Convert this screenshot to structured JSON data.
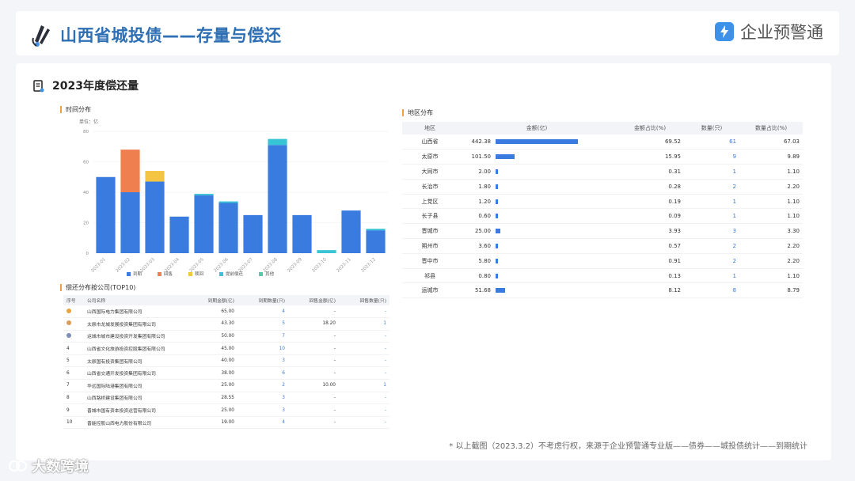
{
  "header": {
    "title": "山西省城投债——存量与偿还",
    "brand": "企业预警通"
  },
  "section": {
    "title": "2023年度偿还量"
  },
  "time_chart": {
    "subtitle": "时间分布",
    "unit": "单位：亿",
    "legend": [
      {
        "label": "到期",
        "color": "#3a7be0"
      },
      {
        "label": "回售",
        "color": "#ef7f4f"
      },
      {
        "label": "赎回",
        "color": "#f4c542"
      },
      {
        "label": "提前偿还",
        "color": "#37c4d4"
      },
      {
        "label": "其他",
        "color": "#58c9a8"
      }
    ]
  },
  "chart_data": {
    "type": "bar",
    "stacked": true,
    "categories": [
      "2023-01",
      "2023-02",
      "2023-03",
      "2023-04",
      "2023-05",
      "2023-06",
      "2023-07",
      "2023-08",
      "2023-09",
      "2023-10",
      "2023-11",
      "2023-12"
    ],
    "series": [
      {
        "name": "到期",
        "color": "#3a7be0",
        "values": [
          50,
          40,
          47,
          24,
          38,
          33,
          25,
          71,
          25,
          0,
          28,
          15
        ]
      },
      {
        "name": "回售",
        "color": "#ef7f4f",
        "values": [
          0,
          28,
          0,
          0,
          0,
          0,
          0,
          0,
          0,
          0,
          0,
          0
        ]
      },
      {
        "name": "赎回",
        "color": "#f4c542",
        "values": [
          0,
          0,
          7,
          0,
          0,
          0,
          0,
          0,
          0,
          0,
          0,
          0
        ]
      },
      {
        "name": "提前偿还",
        "color": "#37c4d4",
        "values": [
          0,
          0,
          0,
          0,
          1,
          1,
          0,
          4,
          0,
          2,
          0,
          1
        ]
      },
      {
        "name": "其他",
        "color": "#58c9a8",
        "values": [
          0,
          0,
          0,
          0,
          0,
          0,
          0,
          0,
          0,
          0,
          0,
          0
        ]
      }
    ],
    "ylim": [
      0,
      80
    ],
    "yticks": [
      0,
      20,
      40,
      60,
      80
    ],
    "grid": true,
    "legend_position": "bottom"
  },
  "top_table": {
    "subtitle": "偿还分布按公司(TOP10)",
    "columns": [
      "序号",
      "公司名称",
      "到期金额(亿)",
      "到期数量(只)",
      "回售金额(亿)",
      "回售数量(只)"
    ],
    "rows": [
      {
        "rank": "",
        "medal": "#e8a43a",
        "name": "山西国际电力集团有限公司",
        "due_amt": "65.00",
        "due_cnt": "4",
        "put_amt": "-",
        "put_cnt": "-"
      },
      {
        "rank": "",
        "medal": "#d89c5a",
        "name": "太原市龙城发展投资集团有限公司",
        "due_amt": "43.30",
        "due_cnt": "5",
        "put_amt": "18.20",
        "put_cnt": "1"
      },
      {
        "rank": "",
        "medal": "#7b8fb8",
        "name": "运城市城市建设投资开发集团有限公司",
        "due_amt": "50.00",
        "due_cnt": "7",
        "put_amt": "-",
        "put_cnt": "-"
      },
      {
        "rank": "4",
        "medal": "",
        "name": "山西省文化旅游投资控股集团有限公司",
        "due_amt": "45.00",
        "due_cnt": "10",
        "put_amt": "-",
        "put_cnt": "-"
      },
      {
        "rank": "5",
        "medal": "",
        "name": "太原国有投资集团有限公司",
        "due_amt": "40.00",
        "due_cnt": "3",
        "put_amt": "-",
        "put_cnt": "-"
      },
      {
        "rank": "6",
        "medal": "",
        "name": "山西省交通开发投资集团有限公司",
        "due_amt": "38.00",
        "due_cnt": "6",
        "put_amt": "-",
        "put_cnt": "-"
      },
      {
        "rank": "7",
        "medal": "",
        "name": "华远国际陆港集团有限公司",
        "due_amt": "25.00",
        "due_cnt": "2",
        "put_amt": "10.00",
        "put_cnt": "1"
      },
      {
        "rank": "8",
        "medal": "",
        "name": "山西路桥建设集团有限公司",
        "due_amt": "28.55",
        "due_cnt": "3",
        "put_amt": "-",
        "put_cnt": "-"
      },
      {
        "rank": "9",
        "medal": "",
        "name": "晋城市国有资本投资运营有限公司",
        "due_amt": "25.00",
        "due_cnt": "3",
        "put_amt": "-",
        "put_cnt": "-"
      },
      {
        "rank": "10",
        "medal": "",
        "name": "晋能控股山西电力股份有限公司",
        "due_amt": "19.00",
        "due_cnt": "4",
        "put_amt": "-",
        "put_cnt": "-"
      }
    ]
  },
  "region_table": {
    "subtitle": "地区分布",
    "columns": [
      "地区",
      "金额(亿)",
      "金额占比(%)",
      "数量(只)",
      "数量占比(%)"
    ],
    "rows": [
      {
        "region": "山西省",
        "amount": "442.38",
        "share": "69.52",
        "count": "61",
        "count_share": "67.03",
        "amount_value": 442.38
      },
      {
        "region": "太原市",
        "amount": "101.50",
        "share": "15.95",
        "count": "9",
        "count_share": "9.89",
        "amount_value": 101.5
      },
      {
        "region": "大同市",
        "amount": "2.00",
        "share": "0.31",
        "count": "1",
        "count_share": "1.10",
        "amount_value": 2.0
      },
      {
        "region": "长治市",
        "amount": "1.80",
        "share": "0.28",
        "count": "2",
        "count_share": "2.20",
        "amount_value": 1.8
      },
      {
        "region": "上党区",
        "amount": "1.20",
        "share": "0.19",
        "count": "1",
        "count_share": "1.10",
        "amount_value": 1.2
      },
      {
        "region": "长子县",
        "amount": "0.60",
        "share": "0.09",
        "count": "1",
        "count_share": "1.10",
        "amount_value": 0.6
      },
      {
        "region": "晋城市",
        "amount": "25.00",
        "share": "3.93",
        "count": "3",
        "count_share": "3.30",
        "amount_value": 25.0
      },
      {
        "region": "朔州市",
        "amount": "3.60",
        "share": "0.57",
        "count": "2",
        "count_share": "2.20",
        "amount_value": 3.6
      },
      {
        "region": "晋中市",
        "amount": "5.80",
        "share": "0.91",
        "count": "2",
        "count_share": "2.20",
        "amount_value": 5.8
      },
      {
        "region": "祁县",
        "amount": "0.80",
        "share": "0.13",
        "count": "1",
        "count_share": "1.10",
        "amount_value": 0.8
      },
      {
        "region": "运城市",
        "amount": "51.68",
        "share": "8.12",
        "count": "8",
        "count_share": "8.79",
        "amount_value": 51.68
      }
    ]
  },
  "footnote": "* 以上截图（2023.3.2）不考虑行权，来源于企业预警通专业版——债券——城投债统计——到期统计",
  "watermark": "大数跨境"
}
